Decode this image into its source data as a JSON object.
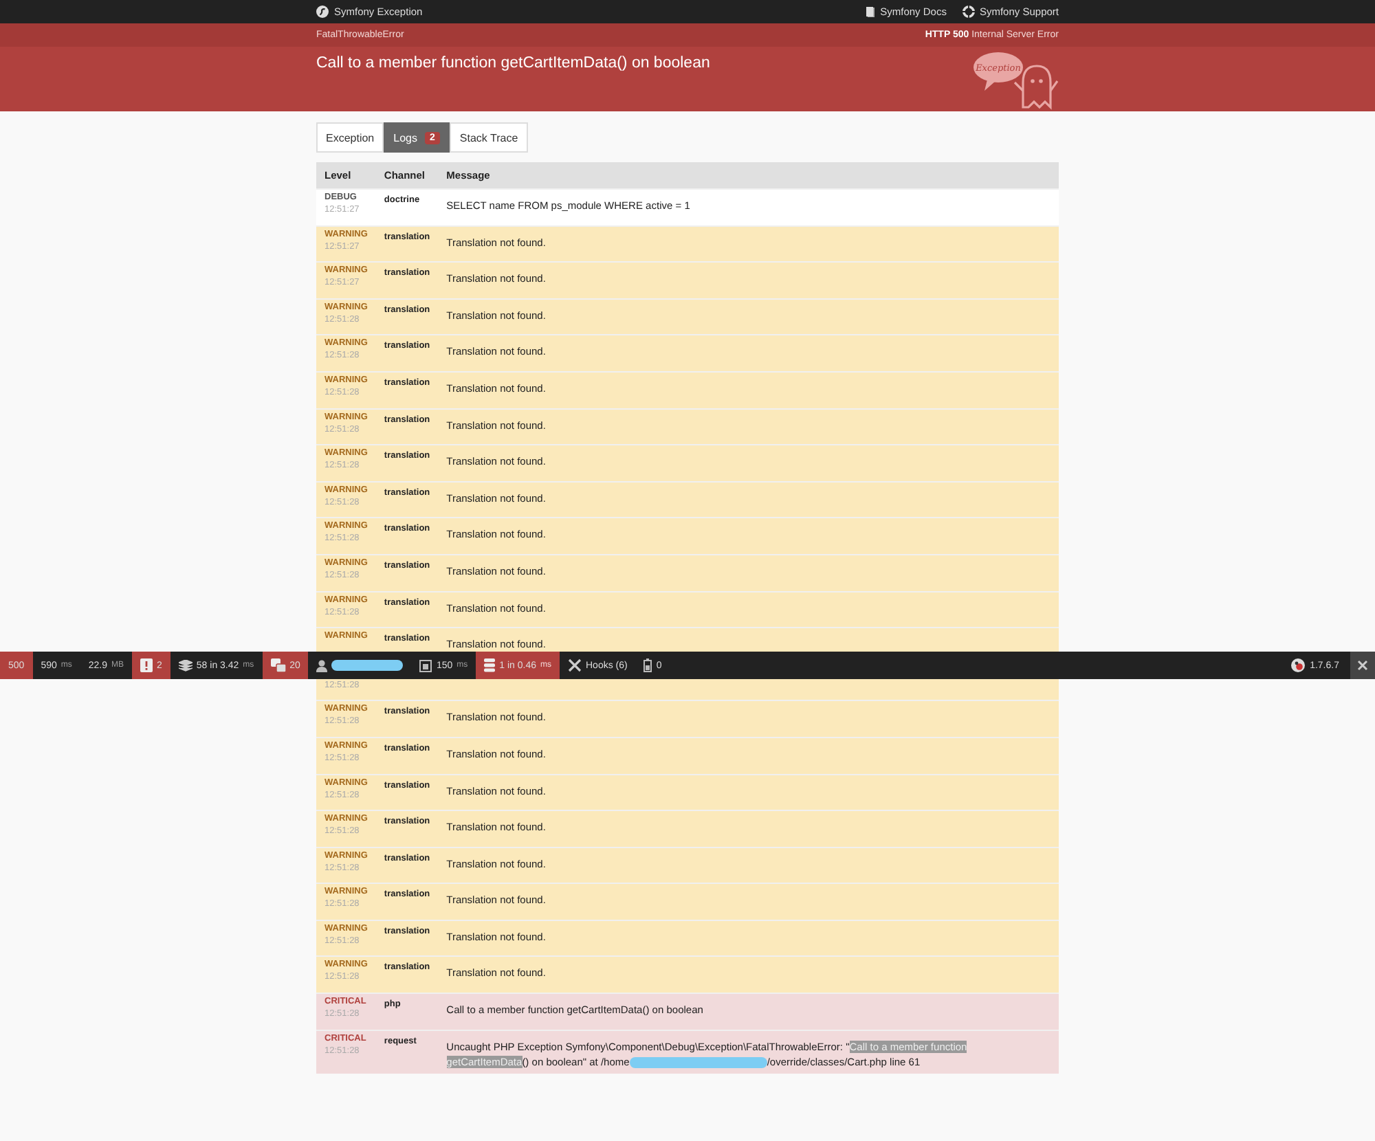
{
  "top_bar": {
    "brand": "Symfony Exception",
    "links": [
      {
        "kind": "docs",
        "label": "Symfony Docs"
      },
      {
        "kind": "support",
        "label": "Symfony Support"
      }
    ]
  },
  "header": {
    "exception_class": "FatalThrowableError",
    "status_code": "HTTP 500",
    "status_text": "Internal Server Error",
    "message": "Call to a member function getCartItemData() on boolean",
    "logo_bubble": "Exception"
  },
  "tabs": [
    {
      "label": "Exception",
      "selected": false
    },
    {
      "label": "Logs",
      "selected": true,
      "badge": "2"
    },
    {
      "label": "Stack Trace",
      "selected": false
    }
  ],
  "table": {
    "columns": [
      "Level",
      "Channel",
      "Message"
    ],
    "rows": [
      {
        "kind": "debug",
        "level": "DEBUG",
        "time": "12:51:27",
        "channel": "doctrine",
        "message": "SELECT name FROM ps_module WHERE active = 1"
      },
      {
        "kind": "warning",
        "level": "WARNING",
        "time": "12:51:27",
        "channel": "translation",
        "message": "Translation not found."
      },
      {
        "kind": "warning",
        "level": "WARNING",
        "time": "12:51:27",
        "channel": "translation",
        "message": "Translation not found."
      },
      {
        "kind": "warning",
        "level": "WARNING",
        "time": "12:51:28",
        "channel": "translation",
        "message": "Translation not found."
      },
      {
        "kind": "warning",
        "level": "WARNING",
        "time": "12:51:28",
        "channel": "translation",
        "message": "Translation not found."
      },
      {
        "kind": "warning",
        "level": "WARNING",
        "time": "12:51:28",
        "channel": "translation",
        "message": "Translation not found."
      },
      {
        "kind": "warning",
        "level": "WARNING",
        "time": "12:51:28",
        "channel": "translation",
        "message": "Translation not found."
      },
      {
        "kind": "warning",
        "level": "WARNING",
        "time": "12:51:28",
        "channel": "translation",
        "message": "Translation not found."
      },
      {
        "kind": "warning",
        "level": "WARNING",
        "time": "12:51:28",
        "channel": "translation",
        "message": "Translation not found."
      },
      {
        "kind": "warning",
        "level": "WARNING",
        "time": "12:51:28",
        "channel": "translation",
        "message": "Translation not found."
      },
      {
        "kind": "warning",
        "level": "WARNING",
        "time": "12:51:28",
        "channel": "translation",
        "message": "Translation not found."
      },
      {
        "kind": "warning",
        "level": "WARNING",
        "time": "12:51:28",
        "channel": "translation",
        "message": "Translation not found."
      },
      {
        "kind": "warning",
        "level": "WARNING",
        "channel": "translation",
        "message": "Translation not found."
      },
      {
        "kind": "warning",
        "time": "12:51:28"
      },
      {
        "kind": "warning",
        "level": "WARNING",
        "time": "12:51:28",
        "channel": "translation",
        "message": "Translation not found."
      },
      {
        "kind": "warning",
        "level": "WARNING",
        "time": "12:51:28",
        "channel": "translation",
        "message": "Translation not found."
      },
      {
        "kind": "warning",
        "level": "WARNING",
        "time": "12:51:28",
        "channel": "translation",
        "message": "Translation not found."
      },
      {
        "kind": "warning",
        "level": "WARNING",
        "time": "12:51:28",
        "channel": "translation",
        "message": "Translation not found."
      },
      {
        "kind": "warning",
        "level": "WARNING",
        "time": "12:51:28",
        "channel": "translation",
        "message": "Translation not found."
      },
      {
        "kind": "warning",
        "level": "WARNING",
        "time": "12:51:28",
        "channel": "translation",
        "message": "Translation not found."
      },
      {
        "kind": "warning",
        "level": "WARNING",
        "time": "12:51:28",
        "channel": "translation",
        "message": "Translation not found."
      },
      {
        "kind": "warning",
        "level": "WARNING",
        "time": "12:51:28",
        "channel": "translation",
        "message": "Translation not found."
      },
      {
        "kind": "critical",
        "level": "CRITICAL",
        "time": "12:51:28",
        "channel": "php",
        "message": "Call to a member function getCartItemData() on boolean"
      },
      {
        "kind": "critical",
        "level": "CRITICAL",
        "time": "12:51:28",
        "channel": "request",
        "message_segments": [
          {
            "kind": "text",
            "text": "Uncaught PHP Exception Symfony\\Component\\Debug\\Exception\\FatalThrowableError: \"",
            "selected": false
          },
          {
            "kind": "text",
            "text": "Call to a member function getCartItemData",
            "selected": true
          },
          {
            "kind": "text",
            "text": "() on boolean\" at /home",
            "selected": false
          },
          {
            "kind": "redacted"
          },
          {
            "kind": "text",
            "text": "/override/classes/Cart.php line 61",
            "selected": false
          }
        ]
      }
    ]
  },
  "debug_toolbar": {
    "items": [
      {
        "kind": "status",
        "value": "500",
        "alert": true
      },
      {
        "kind": "time",
        "value": "590",
        "unit": "ms",
        "alert": false
      },
      {
        "kind": "memory",
        "value": "22.9",
        "unit": "MB",
        "alert": false
      },
      {
        "kind": "errors",
        "value": "2",
        "alert": true
      },
      {
        "kind": "layers",
        "value": "58 in 3.42",
        "unit": "ms",
        "alert": false
      },
      {
        "kind": "translation",
        "value": "20",
        "alert": true
      },
      {
        "kind": "user",
        "alert": false
      },
      {
        "kind": "form",
        "value": "150",
        "unit": "ms",
        "alert": false
      },
      {
        "kind": "database",
        "value": "1 in 0.46",
        "unit": "ms",
        "alert": true
      },
      {
        "kind": "hooks",
        "value": "Hooks (6)",
        "alert": false
      },
      {
        "kind": "cache",
        "value": "0",
        "alert": false
      }
    ],
    "version": "1.7.6.7"
  }
}
